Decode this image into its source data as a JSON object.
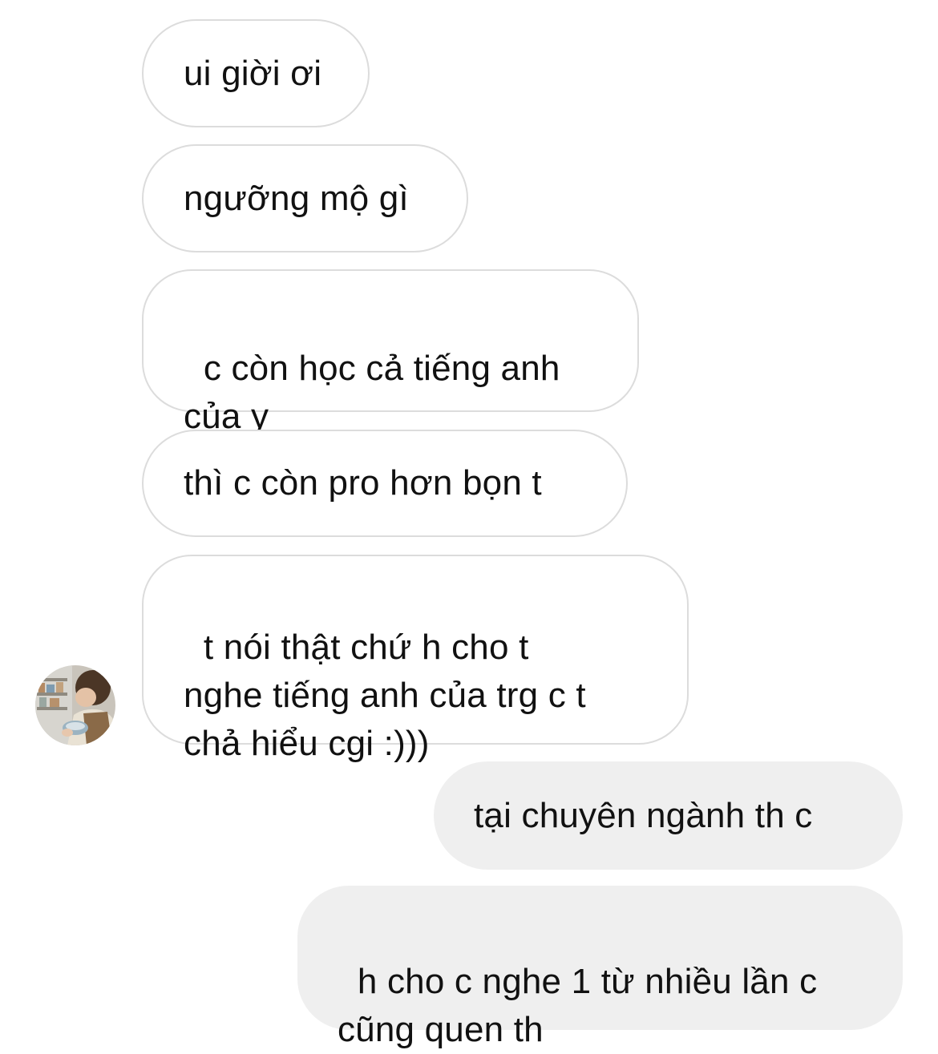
{
  "chat": {
    "messages": [
      {
        "sender": "other",
        "text": "ui giời ơi"
      },
      {
        "sender": "other",
        "text": "ngưỡng mộ gì"
      },
      {
        "sender": "other",
        "text": "c còn học cả tiếng anh\ncủa y"
      },
      {
        "sender": "other",
        "text": "thì c còn pro hơn bọn t"
      },
      {
        "sender": "other",
        "text": "t nói thật chứ h cho t\nnghe tiếng anh của trg c t\nchả hiểu cgi :)))"
      },
      {
        "sender": "me",
        "text": "tại chuyên ngành th c"
      },
      {
        "sender": "me",
        "text": "h cho c nghe 1 từ nhiều lần c\ncũng quen th"
      }
    ]
  },
  "colors": {
    "incoming_bg": "#ffffff",
    "incoming_border": "#dcdcdc",
    "outgoing_bg": "#efefef",
    "text": "#111111"
  },
  "icons": {
    "avatar": "user-avatar-photo"
  }
}
